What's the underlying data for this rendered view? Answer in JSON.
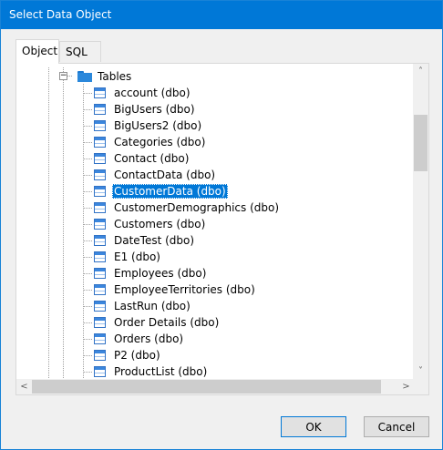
{
  "window": {
    "title": "Select Data Object",
    "close_glyph": "✕"
  },
  "tabs": [
    {
      "label": "Object",
      "active": true
    },
    {
      "label": "SQL",
      "active": false
    }
  ],
  "tree": {
    "folder": {
      "label": "Tables",
      "expander": "−",
      "icon": "folder-icon"
    },
    "items": [
      {
        "label": "account (dbo)",
        "selected": false
      },
      {
        "label": "BigUsers (dbo)",
        "selected": false
      },
      {
        "label": "BigUsers2 (dbo)",
        "selected": false
      },
      {
        "label": "Categories (dbo)",
        "selected": false
      },
      {
        "label": "Contact (dbo)",
        "selected": false
      },
      {
        "label": "ContactData (dbo)",
        "selected": false
      },
      {
        "label": "CustomerData (dbo)",
        "selected": true
      },
      {
        "label": "CustomerDemographics (dbo)",
        "selected": false
      },
      {
        "label": "Customers (dbo)",
        "selected": false
      },
      {
        "label": "DateTest (dbo)",
        "selected": false
      },
      {
        "label": "E1 (dbo)",
        "selected": false
      },
      {
        "label": "Employees (dbo)",
        "selected": false
      },
      {
        "label": "EmployeeTerritories (dbo)",
        "selected": false
      },
      {
        "label": "LastRun (dbo)",
        "selected": false
      },
      {
        "label": "Order Details (dbo)",
        "selected": false
      },
      {
        "label": "Orders (dbo)",
        "selected": false
      },
      {
        "label": "P2 (dbo)",
        "selected": false
      },
      {
        "label": "ProductList (dbo)",
        "selected": false
      }
    ],
    "item_icon": "table-icon"
  },
  "scrollbars": {
    "up": "˄",
    "down": "˅",
    "left": "<",
    "right": ">"
  },
  "buttons": {
    "ok": "OK",
    "cancel": "Cancel"
  },
  "colors": {
    "title_bar": "#0078d7",
    "selection": "#0078d7",
    "table_icon": "#3b86dd"
  }
}
